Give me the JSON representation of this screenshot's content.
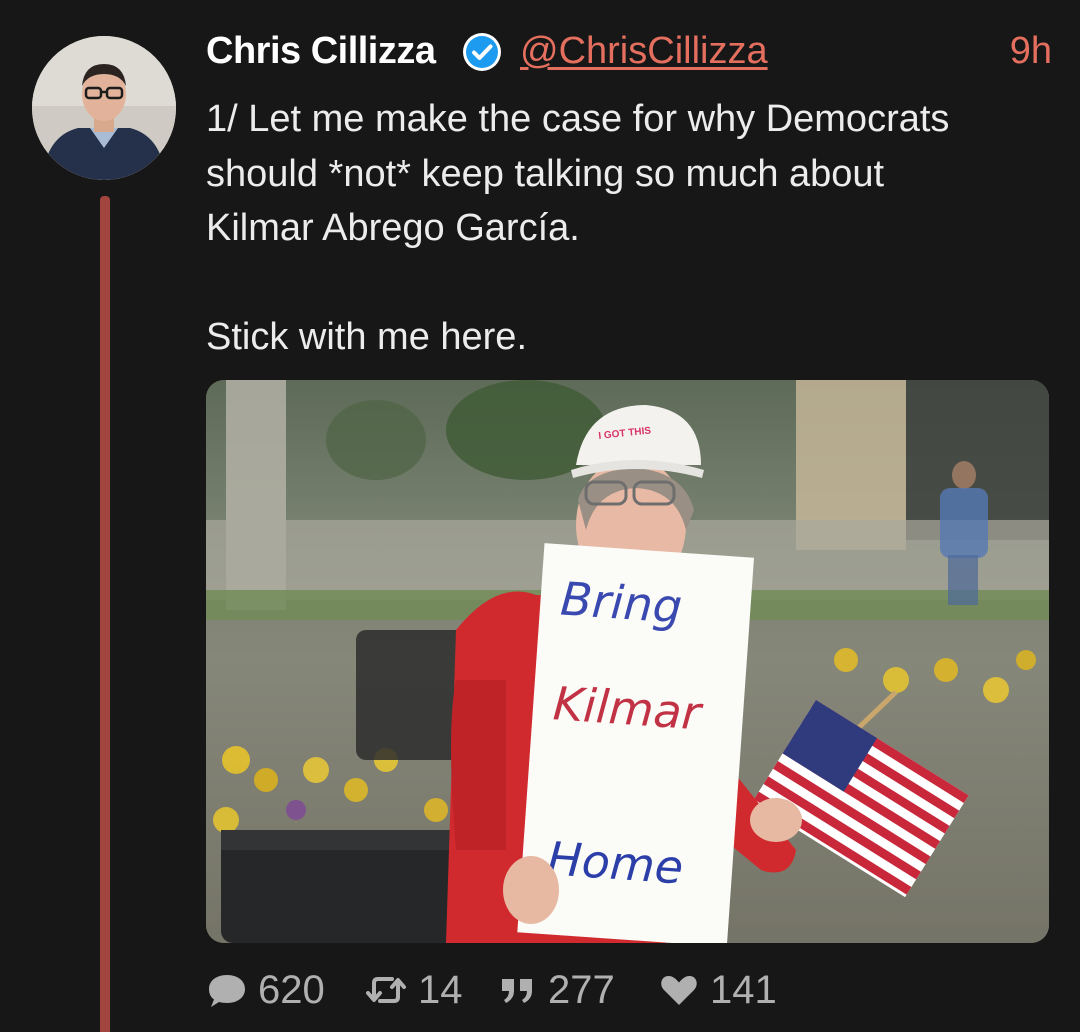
{
  "post": {
    "author_name": "Chris Cillizza",
    "author_handle": "@ChrisCillizza",
    "timestamp": "9h",
    "text_lines": [
      "1/ Let me make the case for why Democrats",
      "should *not* keep talking so much about",
      "Kilmar Abrego García."
    ],
    "text_last": "Stick with me here.",
    "image": {
      "cap_text": "I GOT THIS",
      "sign_line1": "Bring",
      "sign_line2": "Kilmar",
      "sign_line3": "Home"
    }
  },
  "actions": {
    "replies": "620",
    "reposts": "14",
    "quotes": "277",
    "likes": "141"
  },
  "colors": {
    "background": "#171717",
    "accent": "#e46f5f",
    "thread_line": "#a2453e",
    "verified": "#1d9bf0"
  },
  "icons": [
    "verified-badge-icon",
    "reply-bubble-icon",
    "repost-icon",
    "quote-icon",
    "heart-icon"
  ]
}
